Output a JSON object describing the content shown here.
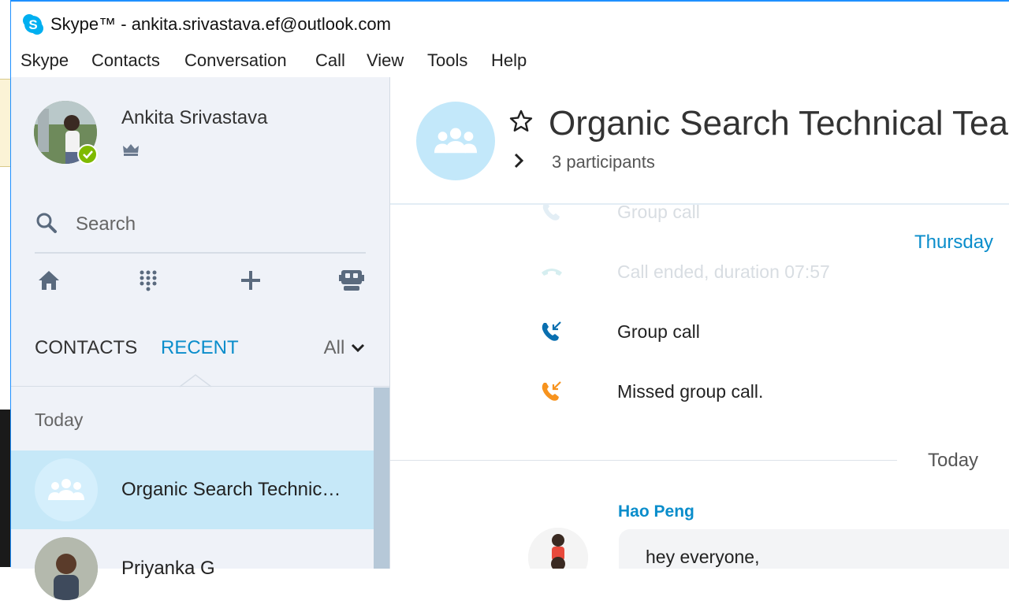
{
  "window": {
    "title": "Skype™ - ankita.srivastava.ef@outlook.com"
  },
  "menu": [
    "Skype",
    "Contacts",
    "Conversation",
    "Call",
    "View",
    "Tools",
    "Help"
  ],
  "profile": {
    "name": "Ankita Srivastava",
    "status": "online"
  },
  "search": {
    "placeholder": "Search"
  },
  "tabs": {
    "contacts": "CONTACTS",
    "recent": "RECENT",
    "filter": "All"
  },
  "recent_list": {
    "group_label": "Today",
    "items": [
      {
        "name": "Organic Search Technic…",
        "selected": true
      },
      {
        "name": "Priyanka G",
        "selected": false
      }
    ]
  },
  "conversation": {
    "title": "Organic Search Technical Team",
    "participants": "3 participants",
    "events": [
      {
        "text": "Group call",
        "type": "incoming",
        "faded": true
      },
      {
        "day": "Thursday"
      },
      {
        "text": "Call ended, duration 07:57",
        "type": "ended",
        "faded": true
      },
      {
        "text": "Group call",
        "type": "incoming",
        "faded": false
      },
      {
        "text": "Missed group call.",
        "type": "missed",
        "faded": false
      },
      {
        "day": "Today"
      }
    ],
    "message": {
      "sender": "Hao Peng",
      "text": "hey everyone,"
    }
  },
  "colors": {
    "accent": "#0a8dcb",
    "missed": "#f7931e",
    "online": "#7fba00",
    "selected_bg": "#c6e8f8"
  }
}
